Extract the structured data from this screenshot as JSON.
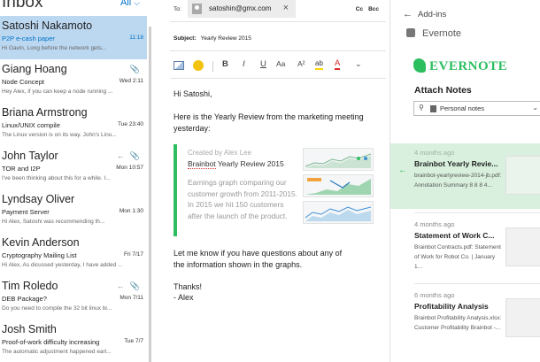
{
  "inbox": {
    "title": "Inbox",
    "filter": "All",
    "messages": [
      {
        "sender": "Satoshi Nakamoto",
        "subject": "P2P e-cash paper",
        "time": "11:18",
        "preview": "Hi Gavin,  Long before the network gets...",
        "attach": false,
        "reply": false
      },
      {
        "sender": "Giang Hoang",
        "subject": "Node Concept",
        "time": "Wed 2:11",
        "preview": "Hey Alex, if you can keep a node running ...",
        "attach": true,
        "reply": false
      },
      {
        "sender": "Briana Armstrong",
        "subject": "Linux/UNIX compile",
        "time": "Tue 23:40",
        "preview": "The Linux version is on its way. John's Linu...",
        "attach": false,
        "reply": false
      },
      {
        "sender": "John Taylor",
        "subject": "TOR and I2P",
        "time": "Mon 10:57",
        "preview": "I've been thinking about this for a while. I...",
        "attach": true,
        "reply": true
      },
      {
        "sender": "Lyndsay Oliver",
        "subject": "Payment Server",
        "time": "Mon 1:30",
        "preview": "Hi Alex, Satoshi was recommending th...",
        "attach": false,
        "reply": false
      },
      {
        "sender": "Kevin Anderson",
        "subject": "Cryptography Mailing List",
        "time": "Fri 7/17",
        "preview": "Hi Alex, As dicussed yesterday, I have added ...",
        "attach": false,
        "reply": false
      },
      {
        "sender": "Tim Roledo",
        "subject": "DEB Package?",
        "time": "Mon 7/11",
        "preview": "Do you need to compile the 32 bit linux bi...",
        "attach": true,
        "reply": true
      },
      {
        "sender": "Josh Smith",
        "subject": "Proof-of-work difficulty increasing",
        "time": "Tue 7/7",
        "preview": "The automatic adjustment happened earl...",
        "attach": false,
        "reply": false
      }
    ]
  },
  "compose": {
    "to_label": "To:",
    "to_email": "satoshin@gmx.com",
    "cc": "Cc",
    "bcc": "Bcc",
    "subject_label": "Subject:",
    "subject_value": "Yearly Review 2015",
    "greeting": "Hi Satoshi,",
    "intro_line1": "Here is the Yearly Review from the marketing meeting",
    "intro_line2": "yesterday:",
    "card": {
      "author": "Created by Alex Lee",
      "title_word1": "Brainbot",
      "title_rest": " Yearly Review 2015",
      "desc": "Earnings graph comparing our customer growth from 2011-2015. In 2015 we hit 150 customers after the launch of the product."
    },
    "outro_line1": "Let me know if you have questions about any of",
    "outro_line2": "the information shown in the graphs.",
    "signoff1": "Thanks!",
    "signoff2": "- Alex"
  },
  "toolbar": {
    "bold": "B",
    "italic": "I",
    "underline": "U",
    "font_size": "Aa",
    "superscript": "A²",
    "highlight": "ab",
    "font_color": "A",
    "more": "⌄"
  },
  "evernote": {
    "back": "Add-ins",
    "addin_name": "Evernote",
    "logo_text": "EVERNOTE",
    "attach_title": "Attach Notes",
    "notebook": "Personal notes",
    "notes": [
      {
        "age": "4 months ago",
        "title": "Brainbot Yearly Revie...",
        "snippet": "brainbot-yearlyreview-2014-jb.pdf: Annotation Summary 8 8 8 4..."
      },
      {
        "age": "4 months ago",
        "title": "Statement of Work C...",
        "snippet": "Brainbot Contracts.pdf: Statement of Work for Robot Co. | January 1..."
      },
      {
        "age": "6 months ago",
        "title": "Profitability Analysis",
        "snippet": "Brainbot Profitability Analysis.xlsx: Customer Profitability Brainbot -..."
      }
    ]
  }
}
